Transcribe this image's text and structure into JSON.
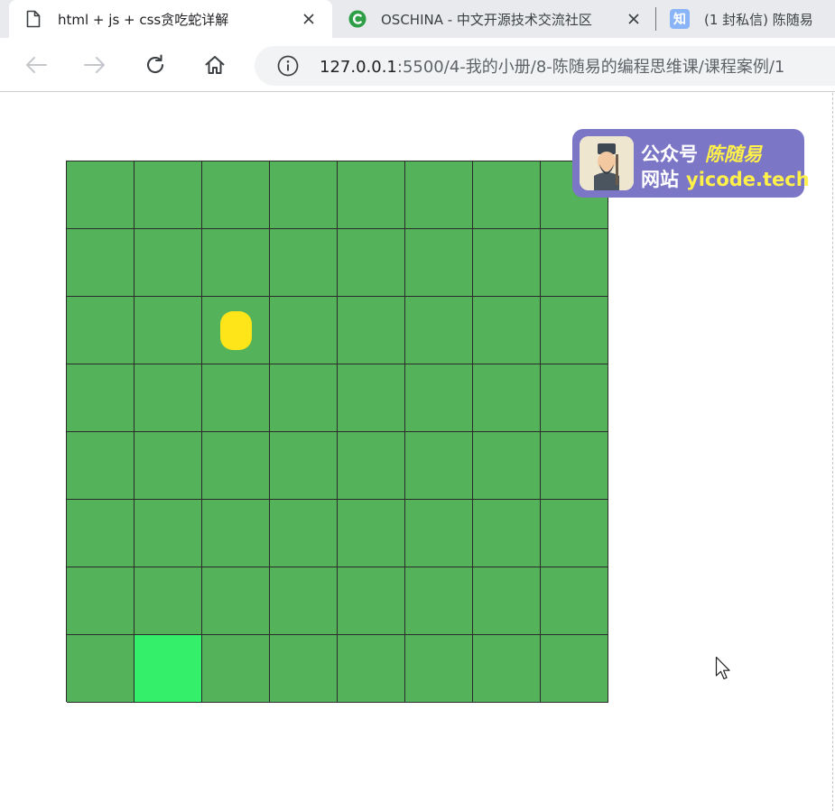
{
  "browser": {
    "tabs": [
      {
        "title": "html + js + css贪吃蛇详解",
        "icon": "document-icon",
        "active": true
      },
      {
        "title": "OSCHINA - 中文开源技术交流社区",
        "icon": "oschina-logo-icon",
        "active": false
      },
      {
        "title": "(1 封私信) 陈随易",
        "icon": "zhihu-logo-icon",
        "icon_text": "知",
        "active": false
      }
    ],
    "address": {
      "host": "127.0.0.1",
      "path": ":5500/4-我的小册/8-陈随易的编程思维课/课程案例/1"
    },
    "colors": {
      "tabstrip": "#e8eaed",
      "omnibox": "#f1f3f4",
      "oschina": "#2e9e47",
      "zhihu": "#8ab4f8"
    }
  },
  "game": {
    "rows": 8,
    "cols": 8,
    "snake_cells": [
      [
        7,
        1
      ]
    ],
    "food_cell": [
      2,
      2
    ],
    "colors": {
      "board": "#54b35a",
      "snake": "#33ef6a",
      "food": "#fde51a",
      "grid_line": "#2b2b2b"
    }
  },
  "watermark": {
    "label1": "公众号",
    "name": "陈随易",
    "label2": "网站",
    "site": "yicode.tech",
    "colors": {
      "background": "#7c76c6",
      "accent": "#fff04a"
    }
  }
}
